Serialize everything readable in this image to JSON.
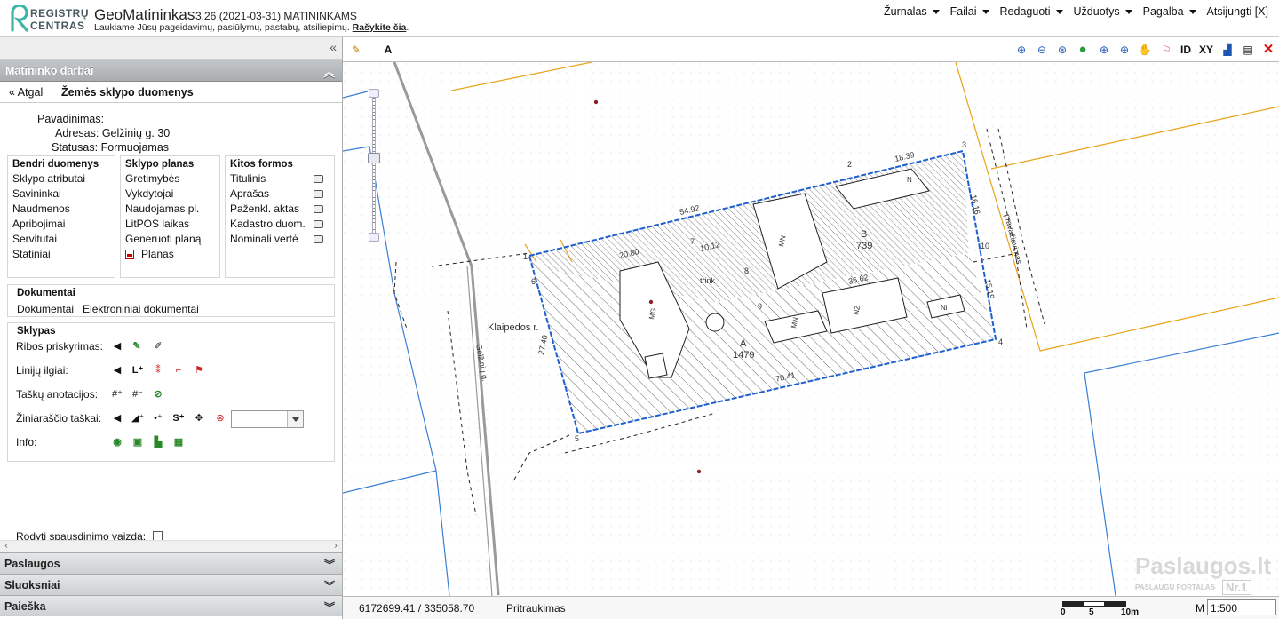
{
  "header": {
    "logo_line1": "REGISTRŲ",
    "logo_line2": "CENTRAS",
    "app_name": "GeoMatininkas",
    "version": "3.26 (2021-03-31) MATININKAMS",
    "subtitle": "Laukiame Jūsų pageidavimų, pasiūlymų, pastabų, atsiliepimų.",
    "subtitle_link": "Rašykite čia",
    "subtitle_end": "."
  },
  "menu": [
    {
      "label": "Žurnalas"
    },
    {
      "label": "Failai"
    },
    {
      "label": "Redaguoti"
    },
    {
      "label": "Užduotys"
    },
    {
      "label": "Pagalba"
    }
  ],
  "menu_logout": "Atsijungti [X]",
  "panel": {
    "collapse_glyph": "«",
    "section_title": "Matininko darbai",
    "back_label": "« Atgal",
    "crumb_title": "Žemės sklypo duomenys"
  },
  "plot": {
    "name_label": "Pavadinimas:",
    "name_value": "",
    "address_label": "Adresas:",
    "address_value": "Gelžinių g. 30",
    "status_label": "Statusas:",
    "status_value": "Formuojamas"
  },
  "general": {
    "title": "Bendri duomenys",
    "items": [
      "Sklypo atributai",
      "Savininkai",
      "Naudmenos",
      "Apribojimai",
      "Servitutai",
      "Statiniai"
    ]
  },
  "plan": {
    "title": "Sklypo planas",
    "items": [
      "Gretimybės",
      "Vykdytojai",
      "Naudojamas pl.",
      "LitPOS laikas",
      "Generuoti planą"
    ],
    "pdf_item": "Planas"
  },
  "forms": {
    "title": "Kitos formos",
    "items": [
      "Titulinis",
      "Aprašas",
      "Paženkl. aktas",
      "Kadastro duom.",
      "Nominali vertė"
    ]
  },
  "documents": {
    "title": "Dokumentai",
    "items": [
      "Dokumentai",
      "Elektroniniai dokumentai"
    ]
  },
  "plots": {
    "title": "Sklypas",
    "rows": [
      "Ribos priskyrimas:",
      "Linijų ilgiai:",
      "Taškų anotacijos:",
      "Žiniaraščio taškai:",
      "Info:"
    ],
    "print_view_label": "Rodyti spausdinimo vaizdą:"
  },
  "accordion": [
    "Paslaugos",
    "Sluoksniai",
    "Paieška"
  ],
  "toolbar": {
    "text_tool": "A",
    "id_label": "ID",
    "xy_label": "XY"
  },
  "status": {
    "coords": "6172699.41 / 335058.70",
    "mode": "Pritraukimas",
    "scale_0": "0",
    "scale_5": "5",
    "scale_10": "10m",
    "scale_label": "M",
    "scale_value": "1:500"
  },
  "map_labels": {
    "road_name": "Klaipėdos r.",
    "street": "Gelžinių g.",
    "pass": "pravažiavimas",
    "plotA": "A",
    "plotA_area": "1479",
    "plotB": "B",
    "plotB_area": "739",
    "trink": "trink",
    "dims": [
      "54.92",
      "18.39",
      "16.16",
      "15.19",
      "70.41",
      "27.40",
      "36.62",
      "10.12",
      "20.80"
    ],
    "pts": [
      "1",
      "2",
      "3",
      "4",
      "5",
      "6",
      "7",
      "8",
      "9",
      "10"
    ],
    "building_tags": [
      "MN",
      "N",
      "MN",
      "NŽ",
      "MG",
      "Ni"
    ]
  },
  "watermark": {
    "line1": "Paslaugos.lt",
    "line2": "PASLAUGŲ PORTALAS",
    "badge": "Nr.1"
  },
  "colors": {
    "panel_header": "#b5b9bc",
    "parcel_blue": "#1e5fd0",
    "boundary_orange": "#e8a317",
    "road_gray": "#9a9a9a"
  }
}
